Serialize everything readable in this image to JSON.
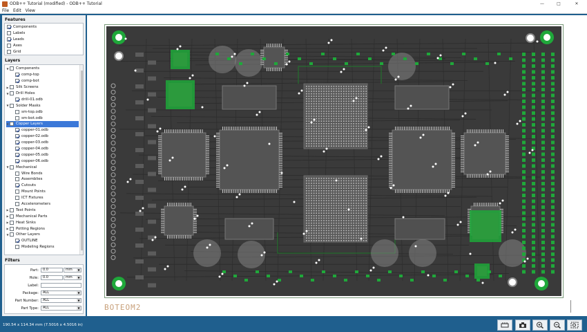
{
  "window": {
    "title": "ODB++ Tutorial (modified) - ODB++ Tutorial",
    "minimize": "—",
    "maximize": "□",
    "close": "✕"
  },
  "menu": [
    "File",
    "Edit",
    "View"
  ],
  "features": {
    "heading": "Features",
    "items": [
      {
        "label": "Components",
        "checked": true
      },
      {
        "label": "Labels",
        "checked": false
      },
      {
        "label": "Leads",
        "checked": true
      },
      {
        "label": "Axes",
        "checked": false
      },
      {
        "label": "Grid",
        "checked": false
      }
    ]
  },
  "layers": {
    "heading": "Layers",
    "items": [
      {
        "label": "Components",
        "level": 0,
        "expander": "▼",
        "checked": false
      },
      {
        "label": "comp-top",
        "level": 1,
        "checked": true
      },
      {
        "label": "comp-bot",
        "level": 1,
        "checked": true
      },
      {
        "label": "Silk Screens",
        "level": 0,
        "expander": "▶",
        "checked": false
      },
      {
        "label": "Drill Holes",
        "level": 0,
        "expander": "▼",
        "checked": false
      },
      {
        "label": "drill-01.odb",
        "level": 1,
        "checked": true
      },
      {
        "label": "Solder Masks",
        "level": 0,
        "expander": "▼",
        "checked": false
      },
      {
        "label": "sm-top.odb",
        "level": 1,
        "checked": false
      },
      {
        "label": "sm-bot.odb",
        "level": 1,
        "checked": false
      },
      {
        "label": "Copper Layers",
        "level": 0,
        "expander": "▼",
        "checked": false,
        "selected": true
      },
      {
        "label": "copper-01.odb",
        "level": 1,
        "checked": true
      },
      {
        "label": "copper-02.odb",
        "level": 1,
        "checked": true
      },
      {
        "label": "copper-03.odb",
        "level": 1,
        "checked": true
      },
      {
        "label": "copper-04.odb",
        "level": 1,
        "checked": true
      },
      {
        "label": "copper-05.odb",
        "level": 1,
        "checked": true
      },
      {
        "label": "copper-06.odb",
        "level": 1,
        "checked": true
      },
      {
        "label": "Mechanical",
        "level": 0,
        "expander": "▼",
        "checked": false
      },
      {
        "label": "Wire Bonds",
        "level": 1,
        "checked": false
      },
      {
        "label": "Assemblies",
        "level": 1,
        "checked": false
      },
      {
        "label": "Cutouts",
        "level": 1,
        "checked": true
      },
      {
        "label": "Mount Points",
        "level": 1,
        "checked": false
      },
      {
        "label": "ICT Fixtures",
        "level": 1,
        "checked": false
      },
      {
        "label": "Accelerometers",
        "level": 1,
        "checked": false
      },
      {
        "label": "Test Points",
        "level": 0,
        "expander": "▶",
        "checked": false
      },
      {
        "label": "Mechanical Parts",
        "level": 0,
        "expander": "▶",
        "checked": false
      },
      {
        "label": "Heat Sinks",
        "level": 0,
        "expander": "▶",
        "checked": false
      },
      {
        "label": "Potting Regions",
        "level": 0,
        "expander": "▶",
        "checked": false
      },
      {
        "label": "Other Layers",
        "level": 0,
        "expander": "▼",
        "checked": false
      },
      {
        "label": "OUTLINE",
        "level": 1,
        "checked": true
      },
      {
        "label": "Modeling Regions",
        "level": 1,
        "checked": false
      }
    ]
  },
  "filters": {
    "heading": "Filters",
    "part": {
      "label": "Part:",
      "value": "0.0",
      "unit": "mm"
    },
    "hole": {
      "label": "Hole:",
      "value": "0.0",
      "unit": "mm"
    },
    "label": {
      "label": "Label:",
      "value": ""
    },
    "package": {
      "label": "Package:",
      "value": "ALL"
    },
    "part_number": {
      "label": "Part Number:",
      "value": "ALL"
    },
    "part_type": {
      "label": "Part Type:",
      "value": "ALL"
    }
  },
  "canvas": {
    "watermark": "BOTEOM2"
  },
  "status": {
    "text": "190.54 x 114.34 mm  (7.5016 x 4.5016 in)"
  },
  "toolbar": [
    {
      "name": "layers-button",
      "icon": "layers-icon"
    },
    {
      "name": "screenshot-button",
      "icon": "camera-icon"
    },
    {
      "name": "zoom-in-button",
      "icon": "zoom-in-icon"
    },
    {
      "name": "zoom-out-button",
      "icon": "zoom-out-icon"
    },
    {
      "name": "zoom-fit-button",
      "icon": "zoom-fit-icon"
    }
  ],
  "colors": {
    "board": "#3a3a3a",
    "copper": "#1f7a2a",
    "pad": "#1fa83a",
    "chrome": "#1f5f8e"
  }
}
